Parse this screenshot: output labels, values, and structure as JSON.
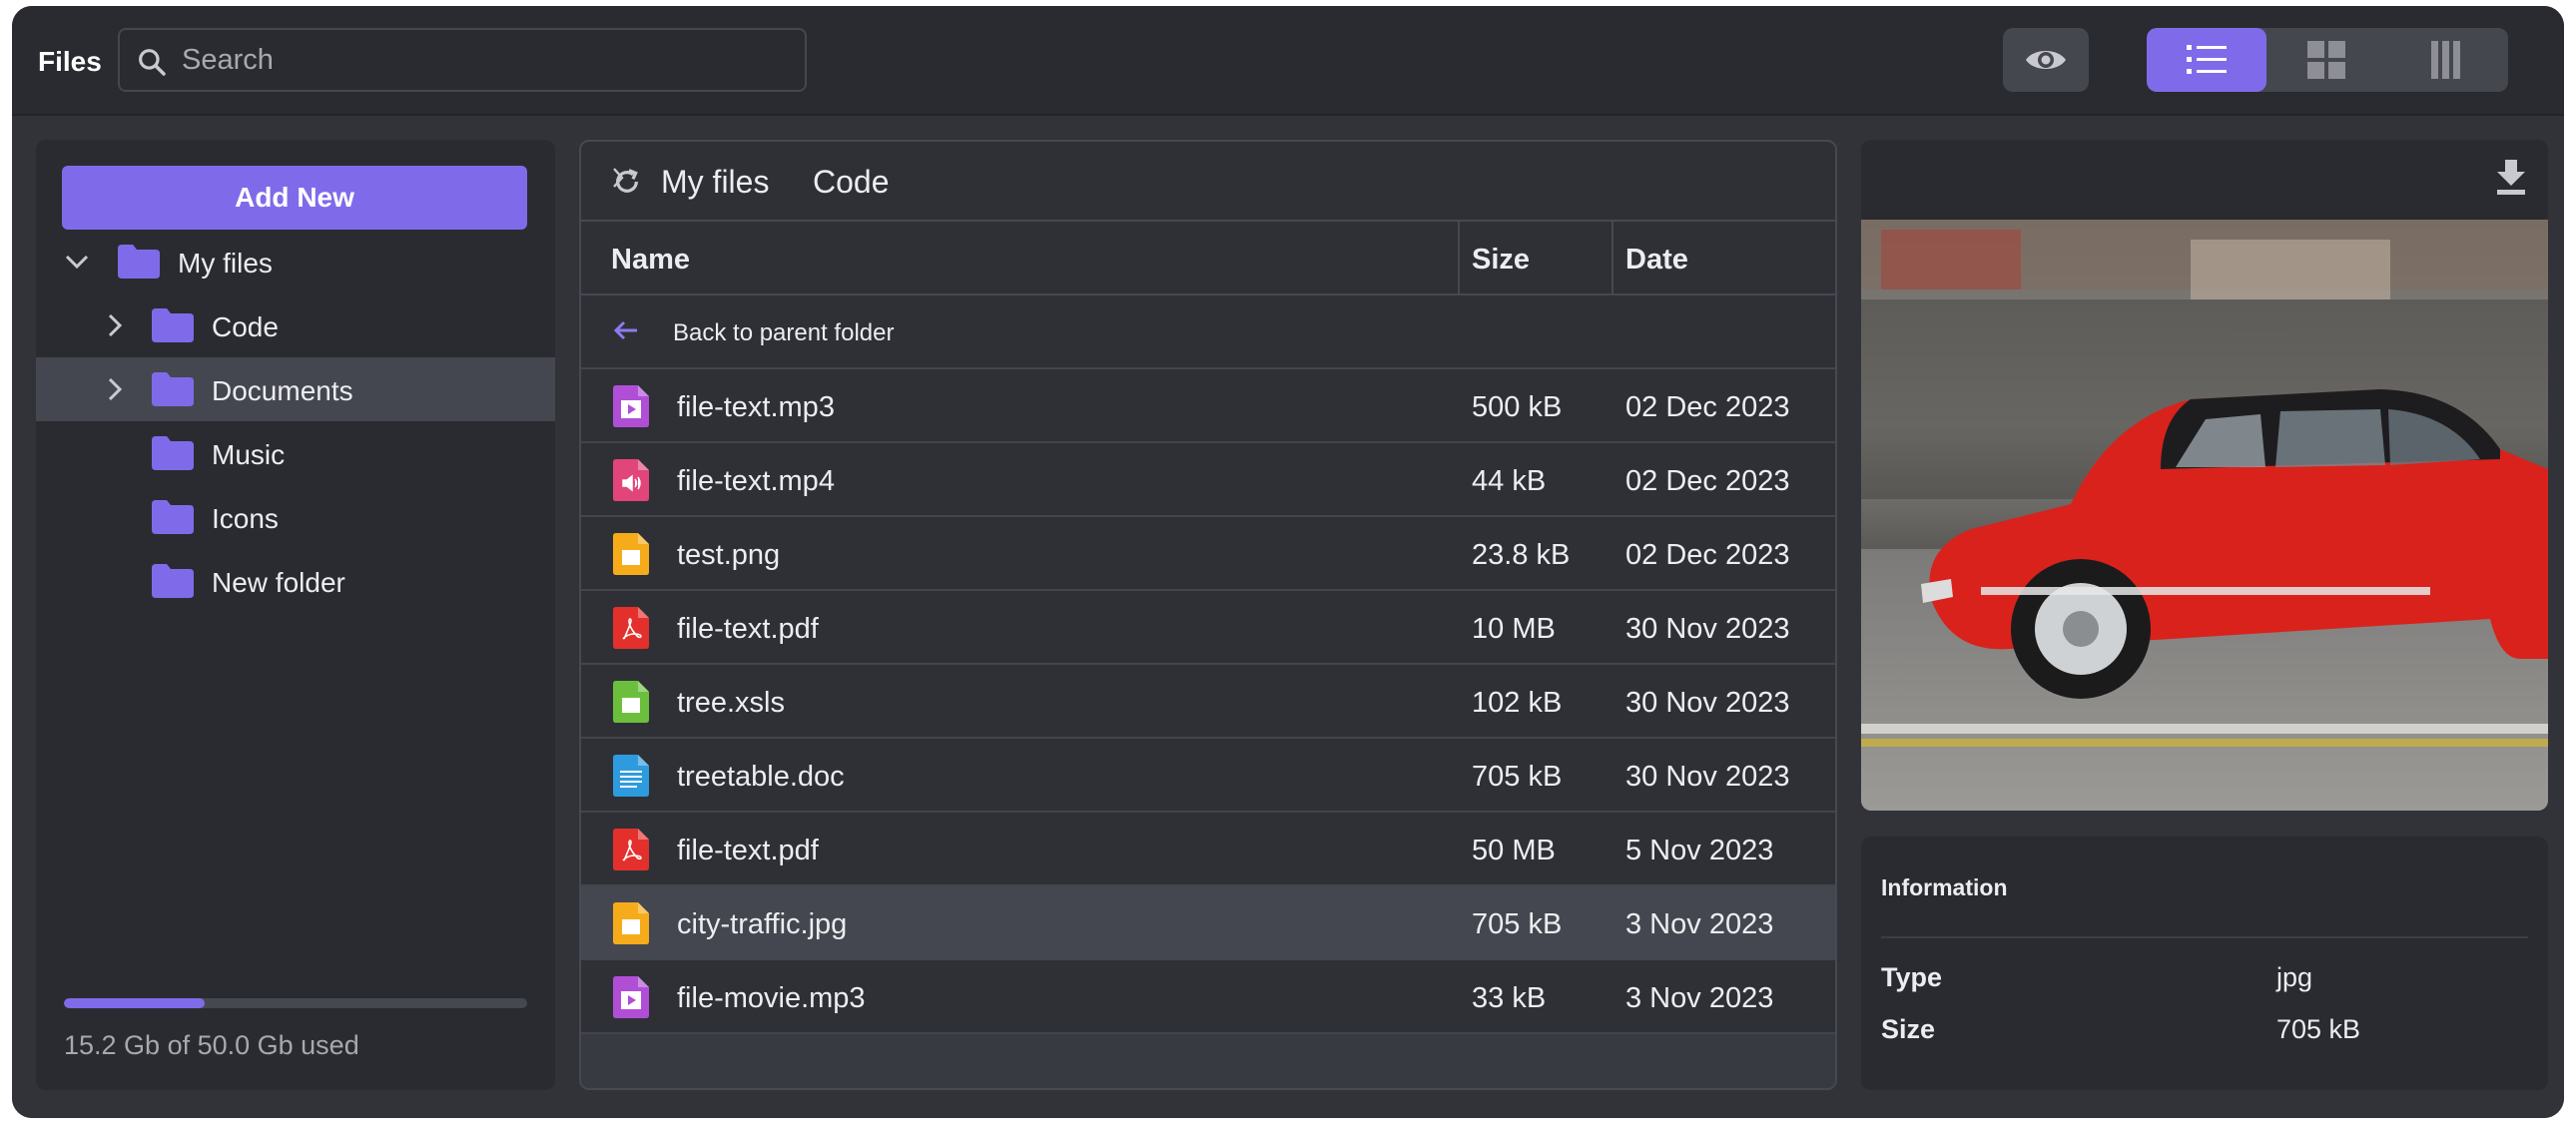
{
  "app": {
    "title": "Files"
  },
  "search": {
    "placeholder": "Search"
  },
  "toolbar": {
    "preview_icon": "eye-icon",
    "views": [
      {
        "icon": "list-view-icon",
        "active": true
      },
      {
        "icon": "grid-view-icon",
        "active": false
      },
      {
        "icon": "columns-view-icon",
        "active": false
      }
    ],
    "accent_color": "#7f6bea"
  },
  "sidebar": {
    "add_new_label": "Add New",
    "tree": [
      {
        "label": "My files",
        "expanded": true,
        "level": 0
      },
      {
        "label": "Code",
        "expandable": true,
        "level": 1
      },
      {
        "label": "Documents",
        "expandable": true,
        "level": 1,
        "selected": true
      },
      {
        "label": "Music",
        "level": 1
      },
      {
        "label": "Icons",
        "level": 1
      },
      {
        "label": "New folder",
        "level": 1
      }
    ],
    "storage": {
      "used_gb": 15.2,
      "total_gb": 50.0,
      "label": "15.2 Gb of 50.0 Gb used"
    }
  },
  "breadcrumb": {
    "root": "My files",
    "current": "Code"
  },
  "table": {
    "columns": [
      "Name",
      "Size",
      "Date"
    ],
    "back_label": "Back to parent folder",
    "rows": [
      {
        "name": "file-text.mp3",
        "size": "500 kB",
        "date": "02 Dec 2023",
        "icon": "video-file-icon",
        "color": "#b04fd6"
      },
      {
        "name": "file-text.mp4",
        "size": "44 kB",
        "date": "02 Dec 2023",
        "icon": "audio-file-icon",
        "color": "#e2457a"
      },
      {
        "name": "test.png",
        "size": "23.8 kB",
        "date": "02 Dec 2023",
        "icon": "image-file-icon",
        "color": "#f6ac1a"
      },
      {
        "name": "file-text.pdf",
        "size": "10 MB",
        "date": "30 Nov 2023",
        "icon": "pdf-file-icon",
        "color": "#e4302c"
      },
      {
        "name": "tree.xsls",
        "size": "102 kB",
        "date": "30 Nov 2023",
        "icon": "spreadsheet-file-icon",
        "color": "#6cbf3c"
      },
      {
        "name": "treetable.doc",
        "size": "705 kB",
        "date": "30 Nov 2023",
        "icon": "document-file-icon",
        "color": "#2e9bde"
      },
      {
        "name": "file-text.pdf",
        "size": "50 MB",
        "date": "5 Nov 2023",
        "icon": "pdf-file-icon",
        "color": "#e4302c"
      },
      {
        "name": "city-traffic.jpg",
        "size": "705 kB",
        "date": "3 Nov 2023",
        "icon": "image-file-icon",
        "color": "#f6ac1a",
        "selected": true
      },
      {
        "name": "file-movie.mp3",
        "size": "33 kB",
        "date": "3 Nov 2023",
        "icon": "video-file-icon",
        "color": "#b04fd6"
      }
    ]
  },
  "preview": {
    "download_icon": "download-icon",
    "image_subject": "red car photo",
    "info_title": "Information",
    "fields": [
      {
        "key": "Type",
        "value": "jpg"
      },
      {
        "key": "Size",
        "value": "705 kB"
      }
    ]
  }
}
